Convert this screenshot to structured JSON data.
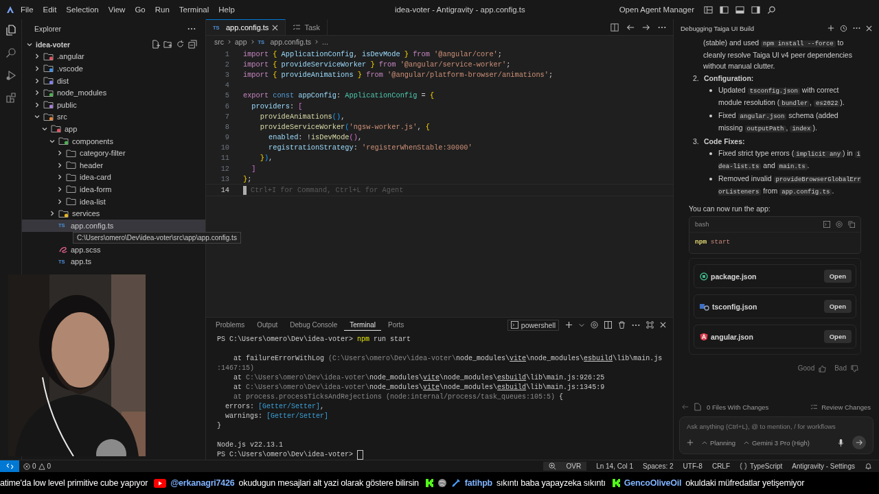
{
  "menu_bar": {
    "items": [
      "File",
      "Edit",
      "Selection",
      "View",
      "Go",
      "Run",
      "Terminal",
      "Help"
    ],
    "title": "idea-voter - Antigravity - app.config.ts",
    "agent_manager": "Open Agent Manager"
  },
  "explorer": {
    "title": "Explorer",
    "tree": [
      {
        "label": "idea-voter",
        "kind": "root",
        "expanded": true,
        "selected": false,
        "children": [
          {
            "label": ".angular",
            "kind": "folder",
            "expanded": false,
            "selected": false,
            "color": "#e0525f"
          },
          {
            "label": ".vscode",
            "kind": "folder",
            "expanded": false,
            "selected": false,
            "color": "#3b8eea"
          },
          {
            "label": "dist",
            "kind": "folder",
            "expanded": false,
            "selected": false,
            "color": "#7f7ff0"
          },
          {
            "label": "node_modules",
            "kind": "folder",
            "expanded": false,
            "selected": false,
            "color": "#4caf50"
          },
          {
            "label": "public",
            "kind": "folder",
            "expanded": false,
            "selected": false,
            "color": "#a77bdb"
          },
          {
            "label": "src",
            "kind": "folder",
            "expanded": true,
            "selected": false,
            "color": "#e5843c",
            "children": [
              {
                "label": "app",
                "kind": "folder",
                "expanded": true,
                "selected": false,
                "color": "#e0525f",
                "children": [
                  {
                    "label": "components",
                    "kind": "folder",
                    "expanded": true,
                    "selected": false,
                    "color": "#4caf50",
                    "children": [
                      {
                        "label": "category-filter",
                        "kind": "folder",
                        "expanded": false,
                        "selected": false
                      },
                      {
                        "label": "header",
                        "kind": "folder",
                        "expanded": false,
                        "selected": false
                      },
                      {
                        "label": "idea-card",
                        "kind": "folder",
                        "expanded": false,
                        "selected": false
                      },
                      {
                        "label": "idea-form",
                        "kind": "folder",
                        "expanded": false,
                        "selected": false
                      },
                      {
                        "label": "idea-list",
                        "kind": "folder",
                        "expanded": false,
                        "selected": false
                      }
                    ]
                  },
                  {
                    "label": "services",
                    "kind": "folder",
                    "expanded": false,
                    "selected": false,
                    "color": "#e6b422"
                  },
                  {
                    "label": "app.config.ts",
                    "kind": "ts",
                    "badge": "TS",
                    "selected": true,
                    "tooltip": "C:\\Users\\omero\\Dev\\idea-voter\\src\\app\\app.config.ts"
                  },
                  {
                    "label": "app.scss",
                    "kind": "scss",
                    "selected": false
                  },
                  {
                    "label": "app.ts",
                    "kind": "ts",
                    "badge": "TS",
                    "selected": false
                  }
                ]
              }
            ]
          }
        ]
      }
    ]
  },
  "editor": {
    "tabs": [
      {
        "label": "app.config.ts",
        "kind": "ts",
        "badge": "TS",
        "selected": true
      },
      {
        "label": "Task",
        "kind": "task",
        "selected": false
      }
    ],
    "breadcrumb": [
      {
        "label": "src",
        "kind": "text"
      },
      {
        "label": "app",
        "kind": "text"
      },
      {
        "label": "app.config.ts",
        "kind": "ts",
        "badge": "TS"
      },
      {
        "label": "...",
        "kind": "text"
      }
    ],
    "lines": [
      {
        "n": "1",
        "current": false,
        "tokens": [
          {
            "text": "import",
            "kind": "kw"
          },
          {
            "text": " {",
            "kind": "br"
          },
          {
            "text": " ApplicationConfig",
            "kind": "var"
          },
          {
            "text": ",",
            "kind": "p"
          },
          {
            "text": " isDevMode",
            "kind": "var"
          },
          {
            "text": " }",
            "kind": "br"
          },
          {
            "text": " from",
            "kind": "kw"
          },
          {
            "text": " '@angular/core'",
            "kind": "str"
          },
          {
            "text": ";",
            "kind": "p"
          }
        ]
      },
      {
        "n": "2",
        "current": false,
        "tokens": [
          {
            "text": "import",
            "kind": "kw"
          },
          {
            "text": " {",
            "kind": "br"
          },
          {
            "text": " provideServiceWorker",
            "kind": "var"
          },
          {
            "text": " }",
            "kind": "br"
          },
          {
            "text": " from",
            "kind": "kw"
          },
          {
            "text": " '@angular/service-worker'",
            "kind": "str"
          },
          {
            "text": ";",
            "kind": "p"
          }
        ]
      },
      {
        "n": "3",
        "current": false,
        "tokens": [
          {
            "text": "import",
            "kind": "kw"
          },
          {
            "text": " {",
            "kind": "br"
          },
          {
            "text": " provideAnimations",
            "kind": "var"
          },
          {
            "text": " }",
            "kind": "br"
          },
          {
            "text": " from",
            "kind": "kw"
          },
          {
            "text": " '@angular/platform-browser/animations'",
            "kind": "str"
          },
          {
            "text": ";",
            "kind": "p"
          }
        ]
      },
      {
        "n": "4",
        "current": false
      },
      {
        "n": "5",
        "current": false,
        "tokens": [
          {
            "text": "export",
            "kind": "kw"
          },
          {
            "text": " const",
            "kind": "st"
          },
          {
            "text": " appConfig",
            "kind": "var"
          },
          {
            "text": ":",
            "kind": "p"
          },
          {
            "text": " ApplicationConfig",
            "kind": "ty"
          },
          {
            "text": " =",
            "kind": "p"
          },
          {
            "text": " {",
            "kind": "br"
          }
        ]
      },
      {
        "n": "6",
        "current": false,
        "tokens": [
          {
            "text": "  providers",
            "kind": "var"
          },
          {
            "text": ":",
            "kind": "p"
          },
          {
            "text": " [",
            "kind": "br2"
          }
        ]
      },
      {
        "n": "7",
        "current": false,
        "tokens": [
          {
            "text": "    provideAnimations",
            "kind": "fn"
          },
          {
            "text": "()",
            "kind": "br3"
          },
          {
            "text": ",",
            "kind": "p"
          }
        ]
      },
      {
        "n": "8",
        "current": false,
        "tokens": [
          {
            "text": "    provideServiceWorker",
            "kind": "fn"
          },
          {
            "text": "(",
            "kind": "br3"
          },
          {
            "text": "'ngsw-worker.js'",
            "kind": "str"
          },
          {
            "text": ",",
            "kind": "p"
          },
          {
            "text": " {",
            "kind": "br"
          }
        ]
      },
      {
        "n": "9",
        "current": false,
        "tokens": [
          {
            "text": "      enabled",
            "kind": "var"
          },
          {
            "text": ": !",
            "kind": "p"
          },
          {
            "text": "isDevMode",
            "kind": "fn"
          },
          {
            "text": "()",
            "kind": "br2"
          },
          {
            "text": ",",
            "kind": "p"
          }
        ]
      },
      {
        "n": "10",
        "current": false,
        "tokens": [
          {
            "text": "      registrationStrategy",
            "kind": "var"
          },
          {
            "text": ":",
            "kind": "p"
          },
          {
            "text": " 'registerWhenStable:30000'",
            "kind": "str"
          }
        ]
      },
      {
        "n": "11",
        "current": false,
        "tokens": [
          {
            "text": "    }",
            "kind": "br"
          },
          {
            "text": ")",
            "kind": "br3"
          },
          {
            "text": ",",
            "kind": "p"
          }
        ]
      },
      {
        "n": "12",
        "current": false,
        "tokens": [
          {
            "text": "  ]",
            "kind": "br2"
          }
        ]
      },
      {
        "n": "13",
        "current": false,
        "tokens": [
          {
            "text": "}",
            "kind": "br"
          },
          {
            "text": ";",
            "kind": "p"
          }
        ]
      },
      {
        "n": "14",
        "current": true,
        "hint": "Ctrl+I for Command, Ctrl+L for Agent"
      }
    ]
  },
  "panel": {
    "tabs": [
      {
        "label": "Problems",
        "selected": false
      },
      {
        "label": "Output",
        "selected": false
      },
      {
        "label": "Debug Console",
        "selected": false
      },
      {
        "label": "Terminal",
        "selected": true
      },
      {
        "label": "Ports",
        "selected": false
      }
    ],
    "shell": "powershell",
    "lines": [
      {
        "kind": "output",
        "segments": [
          {
            "text": "PS C:\\Users\\omero\\Dev\\idea-voter> ",
            "kind": "text"
          },
          {
            "text": "npm",
            "kind": "cmd"
          },
          {
            "text": " run start",
            "kind": "text"
          }
        ]
      },
      {
        "kind": "blank"
      },
      {
        "kind": "output",
        "segments": [
          {
            "text": "    at failureErrorWithLog ",
            "kind": "text"
          },
          {
            "text": "(C:\\Users\\omero\\Dev\\idea-voter\\",
            "kind": "dim"
          },
          {
            "text": "node_modules\\",
            "kind": "text"
          },
          {
            "text": "vite",
            "kind": "ul"
          },
          {
            "text": "\\node_modules\\",
            "kind": "text"
          },
          {
            "text": "esbuild",
            "kind": "ul"
          },
          {
            "text": "\\lib\\main.js",
            "kind": "text"
          }
        ]
      },
      {
        "kind": "output",
        "segments": [
          {
            "text": ":1467:15)",
            "kind": "dim"
          }
        ]
      },
      {
        "kind": "output",
        "segments": [
          {
            "text": "    at ",
            "kind": "text"
          },
          {
            "text": "C:\\Users\\omero\\Dev\\idea-voter\\",
            "kind": "dim"
          },
          {
            "text": "node_modules\\",
            "kind": "text"
          },
          {
            "text": "vite",
            "kind": "ul"
          },
          {
            "text": "\\node_modules\\",
            "kind": "text"
          },
          {
            "text": "esbuild",
            "kind": "ul"
          },
          {
            "text": "\\lib\\main.js:926:25",
            "kind": "text"
          }
        ]
      },
      {
        "kind": "output",
        "segments": [
          {
            "text": "    at ",
            "kind": "text"
          },
          {
            "text": "C:\\Users\\omero\\Dev\\idea-voter\\",
            "kind": "dim"
          },
          {
            "text": "node_modules\\",
            "kind": "text"
          },
          {
            "text": "vite",
            "kind": "ul"
          },
          {
            "text": "\\node_modules\\",
            "kind": "text"
          },
          {
            "text": "esbuild",
            "kind": "ul"
          },
          {
            "text": "\\lib\\main.js:1345:9",
            "kind": "text"
          }
        ]
      },
      {
        "kind": "output",
        "segments": [
          {
            "text": "    at process.processTicksAndRejections (node:internal/process/task_queues:105:5) ",
            "kind": "dim"
          },
          {
            "text": "{",
            "kind": "text"
          }
        ]
      },
      {
        "kind": "output",
        "segments": [
          {
            "text": "  errors: ",
            "kind": "text"
          },
          {
            "text": "[Getter/Setter]",
            "kind": "cyan"
          },
          {
            "text": ",",
            "kind": "text"
          }
        ]
      },
      {
        "kind": "output",
        "segments": [
          {
            "text": "  warnings: ",
            "kind": "text"
          },
          {
            "text": "[Getter/Setter]",
            "kind": "cyan"
          }
        ]
      },
      {
        "kind": "output",
        "segments": [
          {
            "text": "}",
            "kind": "text"
          }
        ]
      },
      {
        "kind": "blank"
      },
      {
        "kind": "output",
        "segments": [
          {
            "text": "Node.js v22.13.1",
            "kind": "text"
          }
        ]
      },
      {
        "kind": "prompt",
        "segments": [
          {
            "text": "PS C:\\Users\\omero\\Dev\\idea-voter> ",
            "kind": "text"
          }
        ]
      }
    ]
  },
  "agent": {
    "title": "Debugging Taiga UI Build",
    "intro": [
      {
        "text": "(stable) and used ",
        "kind": "text"
      },
      {
        "text": "npm install --force",
        "kind": "code"
      },
      {
        "text": " to cleanly resolve Taiga UI v4 peer dependencies without manual clutter.",
        "kind": "text"
      }
    ],
    "sections": [
      {
        "number": "2.",
        "heading": "Configuration:",
        "bullets": [
          [
            {
              "text": "Updated ",
              "kind": "text"
            },
            {
              "text": "tsconfig.json",
              "kind": "code"
            },
            {
              "text": " with correct module resolution (",
              "kind": "text"
            },
            {
              "text": "bundler",
              "kind": "code"
            },
            {
              "text": ", ",
              "kind": "text"
            },
            {
              "text": "es2022",
              "kind": "code"
            },
            {
              "text": ").",
              "kind": "text"
            }
          ],
          [
            {
              "text": "Fixed ",
              "kind": "text"
            },
            {
              "text": "angular.json",
              "kind": "code"
            },
            {
              "text": " schema (added missing ",
              "kind": "text"
            },
            {
              "text": "outputPath",
              "kind": "code"
            },
            {
              "text": ", ",
              "kind": "text"
            },
            {
              "text": "index",
              "kind": "code"
            },
            {
              "text": ").",
              "kind": "text"
            }
          ]
        ]
      },
      {
        "number": "3.",
        "heading": "Code Fixes:",
        "bullets": [
          [
            {
              "text": "Fixed strict type errors (",
              "kind": "text"
            },
            {
              "text": "implicit any",
              "kind": "code"
            },
            {
              "text": ") in ",
              "kind": "text"
            },
            {
              "text": "idea-list.ts",
              "kind": "code"
            },
            {
              "text": " and ",
              "kind": "text"
            },
            {
              "text": "main.ts",
              "kind": "code"
            },
            {
              "text": ".",
              "kind": "text"
            }
          ],
          [
            {
              "text": "Removed invalid ",
              "kind": "text"
            },
            {
              "text": "provideBrowserGlobalErrorListeners",
              "kind": "code"
            },
            {
              "text": " from ",
              "kind": "text"
            },
            {
              "text": "app.config.ts",
              "kind": "code"
            },
            {
              "text": ".",
              "kind": "text"
            }
          ]
        ]
      }
    ],
    "run_note": "You can now run the app:",
    "code_block": {
      "language": "bash",
      "tokens": [
        {
          "text": "npm",
          "kind": "cmd"
        },
        {
          "text": " start",
          "kind": "arg"
        }
      ]
    },
    "files": [
      {
        "name": "package.json",
        "kind": "npm",
        "button": "Open"
      },
      {
        "name": "tsconfig.json",
        "kind": "tsconfig",
        "button": "Open"
      },
      {
        "name": "angular.json",
        "kind": "angular",
        "button": "Open"
      }
    ],
    "feedback": {
      "good": "Good",
      "bad": "Bad"
    },
    "changes": "0 Files With Changes",
    "review": "Review Changes",
    "input": {
      "placeholder": "Ask anything (Ctrl+L), @ to mention, / for workflows",
      "mode": "Planning",
      "model": "Gemini 3 Pro (High)"
    }
  },
  "status_bar": {
    "errors": "0",
    "warnings": "0",
    "items": [
      {
        "label": "OVR",
        "kind": "zoom"
      },
      {
        "label": "Ln 14, Col 1",
        "kind": "text"
      },
      {
        "label": "Spaces: 2",
        "kind": "text"
      },
      {
        "label": "UTF-8",
        "kind": "text"
      },
      {
        "label": "CRLF",
        "kind": "text"
      },
      {
        "label": "TypeScript",
        "kind": "lang"
      },
      {
        "label": "Antigravity - Settings",
        "kind": "text"
      }
    ]
  },
  "ticker": [
    {
      "kind": "none",
      "badged": false,
      "text": "atime'da low level primitive cube yapıyor"
    },
    {
      "kind": "youtube",
      "badged": false,
      "user": "@erkanagri7426",
      "text": "okudugun mesajlari alt yazi olarak göstere bilirsin"
    },
    {
      "kind": "kick",
      "badged": true,
      "user": "fatihpb",
      "text": "sıkıntı baba yapayzeka sıkıntı"
    },
    {
      "kind": "kick",
      "badged": false,
      "user": "GencoOliveOil",
      "text": "okuldaki müfredatlar yetişemiyor"
    }
  ]
}
